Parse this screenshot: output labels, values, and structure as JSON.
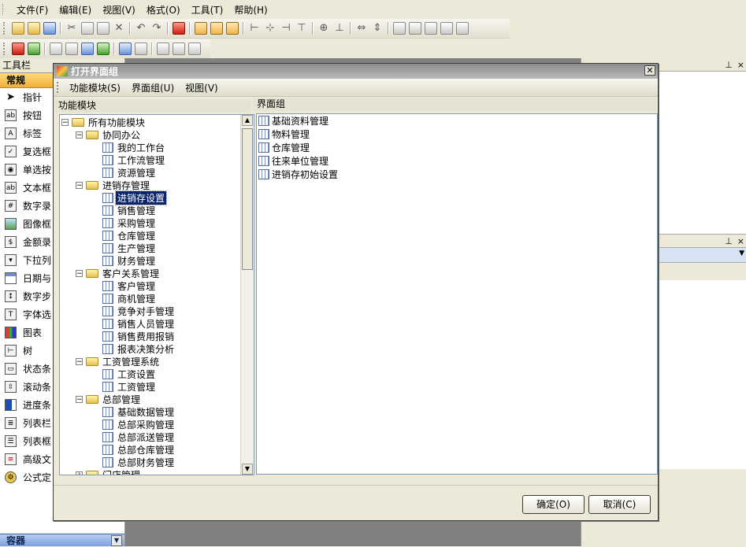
{
  "menubar": {
    "items": [
      "文件(F)",
      "编辑(E)",
      "视图(V)",
      "格式(O)",
      "工具(T)",
      "帮助(H)"
    ]
  },
  "toolbox": {
    "header": "工具栏",
    "tab": "常规",
    "items": [
      "指针",
      "按钮",
      "标签",
      "复选框",
      "单选按",
      "文本框",
      "数字录",
      "图像框",
      "金额录",
      "下拉列",
      "日期与",
      "数字步",
      "字体选",
      "图表",
      "树",
      "状态条",
      "滚动条",
      "进度条",
      "列表栏",
      "列表框",
      "高级文",
      "公式定"
    ],
    "footer": "容器"
  },
  "dialog": {
    "title": "打开界面组",
    "menu": [
      "功能模块(S)",
      "界面组(U)",
      "视图(V)"
    ],
    "left_label": "功能模块",
    "right_label": "界面组",
    "tree": {
      "root": "所有功能模块",
      "groups": [
        {
          "label": "协同办公",
          "children": [
            "我的工作台",
            "工作流管理",
            "资源管理"
          ]
        },
        {
          "label": "进销存管理",
          "children": [
            "进销存设置",
            "销售管理",
            "采购管理",
            "仓库管理",
            "生产管理",
            "财务管理"
          ]
        },
        {
          "label": "客户关系管理",
          "children": [
            "客户管理",
            "商机管理",
            "竞争对手管理",
            "销售人员管理",
            "销售费用报销",
            "报表决策分析"
          ]
        },
        {
          "label": "工资管理系统",
          "children": [
            "工资设置",
            "工资管理"
          ]
        },
        {
          "label": "总部管理",
          "children": [
            "基础数据管理",
            "总部采购管理",
            "总部派送管理",
            "总部仓库管理",
            "总部财务管理"
          ]
        },
        {
          "label": "门店管理",
          "children": []
        }
      ],
      "selected": "进销存设置"
    },
    "list": [
      "基础资料管理",
      "物料管理",
      "仓库管理",
      "往来单位管理",
      "进销存初始设置"
    ],
    "ok_label": "确定(O)",
    "cancel_label": "取消(C)"
  }
}
